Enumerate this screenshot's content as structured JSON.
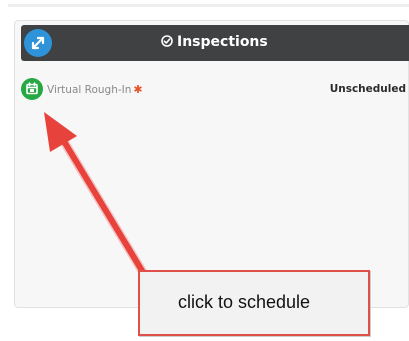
{
  "panel": {
    "title": "Inspections",
    "icons": {
      "expand": "expand-arrows-icon",
      "title_check": "check-circle-icon",
      "calendar": "calendar-icon"
    },
    "colors": {
      "header_bg": "#3f4143",
      "expand_btn": "#2e93d9",
      "calendar_icon": "#27a844",
      "required_mark": "#e8542a"
    }
  },
  "inspections": [
    {
      "label": "Virtual Rough-In",
      "required_mark": "✱",
      "status": "Unscheduled"
    }
  ],
  "annotation": {
    "callout_text": "click to schedule",
    "colors": {
      "arrow": "#e8423c",
      "box_border": "#e0504a"
    }
  }
}
